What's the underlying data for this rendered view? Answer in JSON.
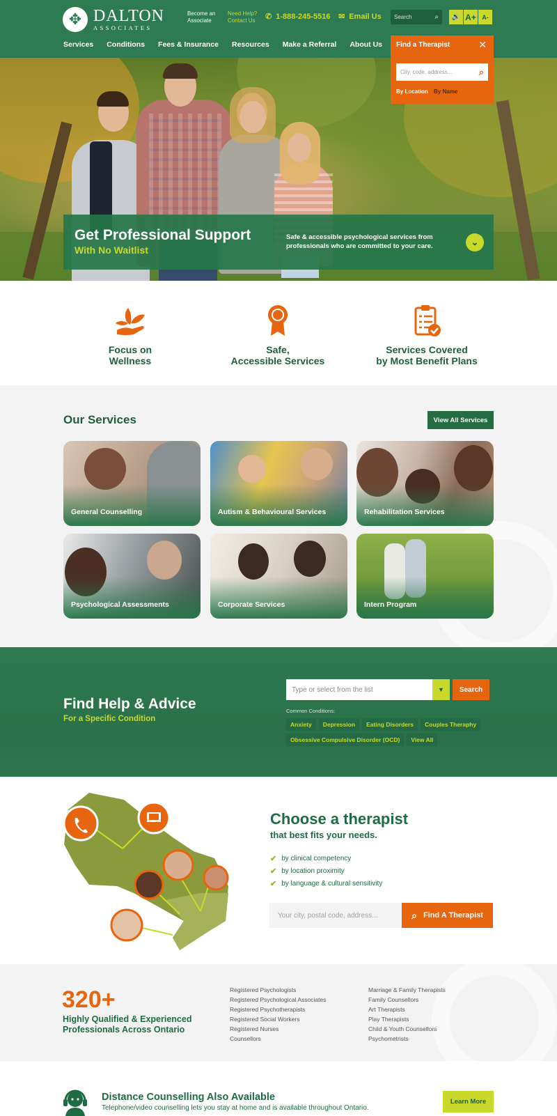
{
  "header": {
    "logo_name": "DALTON",
    "logo_sub": "ASSOCIATES",
    "become_associate": "Become an Associate",
    "need_help": "Need Help?",
    "contact_us": "Contact Us",
    "phone": "1-888-245-5516",
    "email_label": "Email Us",
    "search_placeholder": "Search",
    "accessibility": [
      "▶",
      "A+",
      "A-"
    ]
  },
  "nav": [
    "Services",
    "Conditions",
    "Fees & Insurance",
    "Resources",
    "Make a Referral",
    "About Us"
  ],
  "find_therapist": {
    "title": "Find a Therapist",
    "close": "✕",
    "placeholder": "City, code, address...",
    "tab_location": "By Location",
    "tab_name": "By Name"
  },
  "hero": {
    "title": "Get Professional Support",
    "subtitle": "With No Waitlist",
    "description": "Safe & accessible psychological services from professionals who are committed to your care."
  },
  "features": [
    {
      "line1": "Focus on",
      "line2": "Wellness"
    },
    {
      "line1": "Safe,",
      "line2": "Accessible Services"
    },
    {
      "line1": "Services Covered",
      "line2": "by Most Benefit Plans"
    }
  ],
  "services": {
    "heading": "Our Services",
    "view_all": "View All Services",
    "cards": [
      "General Counselling",
      "Autism & Behavioural Services",
      "Rehabilitation Services",
      "Psychological Assessments",
      "Corporate Services",
      "Intern Program"
    ]
  },
  "help": {
    "title": "Find Help & Advice",
    "subtitle": "For a Specific Condition",
    "select_placeholder": "Type or select from the list",
    "search_button": "Search",
    "common_label": "Common Conditions:",
    "tags": [
      "Anxiety",
      "Depression",
      "Eating Disorders",
      "Couples Theraphy",
      "Obsessive Compulsive Disorder (OCD)",
      "View All"
    ]
  },
  "choose": {
    "title": "Choose a therapist",
    "subtitle": "that best fits your needs.",
    "bullets": [
      "by clinical competency",
      "by location proximity",
      "by language & cultural sensitivity"
    ],
    "placeholder": "Your city, postal code, address...",
    "button": "Find A Therapist"
  },
  "stats": {
    "number": "320+",
    "description": "Highly Qualified & Experienced Professionals Across Ontario",
    "col1": [
      "Registered Psychologists",
      "Registered Psychological Associates",
      "Registered Psychotherapists",
      "Registered Social Workers",
      "Registered Nurses",
      "Counsellors"
    ],
    "col2": [
      "Marriage & Family Therapists",
      "Family Counsellors",
      "Art Therapists",
      "Play Therapists",
      "Child & Youth Counsellors",
      "Psychometrists"
    ]
  },
  "distance": {
    "title": "Distance Counselling Also Available",
    "description": "Telephone/video counselling lets you stay at home and is available throughout Ontario.",
    "button": "Learn More"
  },
  "colors": {
    "green": "#2e7a52",
    "dark_green": "#1f5e3f",
    "orange": "#e8650f",
    "lime": "#c8d92b"
  }
}
